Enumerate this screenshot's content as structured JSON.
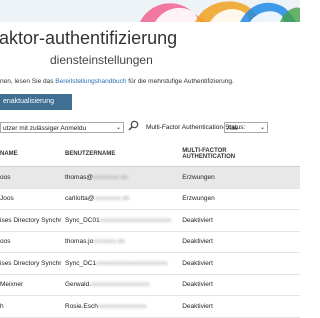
{
  "header": {
    "title": "aktor-authentifizierung",
    "subtitle": "diensteinstellungen"
  },
  "intro": {
    "prefix": "nen, lesen Sie das ",
    "link": "Bereitstellungshandbuch",
    "suffix": " für die mehrstufige Authentifizierung."
  },
  "toolbar": {
    "refresh_label": "enaktualisierung"
  },
  "filters": {
    "view_value": "utzer mit zulässiger Anmeldu",
    "status_label": "Multi-Factor Authentication-Status:",
    "status_value": "Alle"
  },
  "table": {
    "headers": {
      "name": "NAME",
      "username": "BENUTZERNAME",
      "mfa_line1": "MULTI-FACTOR",
      "mfa_line2": "AUTHENTICATION"
    },
    "rows": [
      {
        "name": "oos",
        "user_prefix": "thomas@",
        "user_rest": "xxxxxxxx.de",
        "status": "Erzwungen"
      },
      {
        "name": "Joos",
        "user_prefix": "carllotta@",
        "user_rest": "xxxxxxxx.de",
        "status": "Erzwungen"
      },
      {
        "name": "ises Directory Synchr",
        "user_prefix": "Sync_DC01",
        "user_rest": "xxxxxxxxxxxxxxxxxxxxxx",
        "status": "Deaktiviert"
      },
      {
        "name": "oos",
        "user_prefix": "thomas.jo",
        "user_rest": "xxxxxxx.de",
        "status": "Deaktiviert"
      },
      {
        "name": "ises Directory Synchr",
        "user_prefix": "Sync_DC1",
        "user_rest": "xxxxxxxxxxxxxxxxxxxxxx",
        "status": "Deaktiviert"
      },
      {
        "name": "Meixner",
        "user_prefix": "Gerwald.",
        "user_rest": "xxxxxxxxxxxxxxxxxx",
        "status": "Deaktiviert"
      },
      {
        "name": "h",
        "user_prefix": "Rosie.Esch",
        "user_rest": "xxxxxxxxxxxxxxx",
        "status": "Deaktiviert"
      }
    ]
  }
}
